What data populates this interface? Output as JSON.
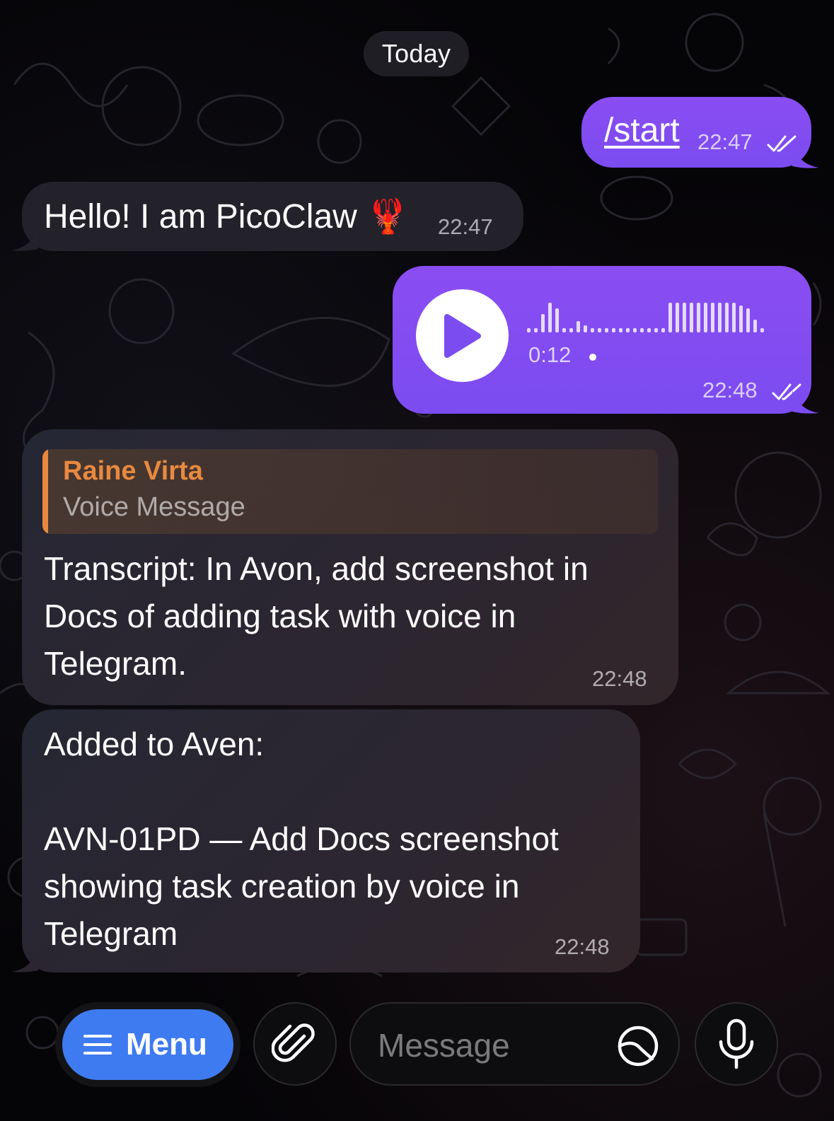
{
  "date_separator": "Today",
  "messages": [
    {
      "id": "start",
      "direction": "outgoing",
      "text": "/start",
      "time": "22:47",
      "status": "read"
    },
    {
      "id": "hello",
      "direction": "incoming",
      "text": "Hello! I am PicoClaw 🦞",
      "time": "22:47"
    },
    {
      "id": "voice",
      "direction": "outgoing",
      "type": "voice",
      "duration": "0:12",
      "time": "22:48",
      "status": "read"
    },
    {
      "id": "transcript",
      "direction": "incoming",
      "reply": {
        "name": "Raine Virta",
        "subtitle": "Voice Message"
      },
      "text": "Transcript: In Avon, add screenshot in Docs of adding task with voice in Telegram.",
      "time": "22:48"
    },
    {
      "id": "added",
      "direction": "incoming",
      "text": "Added to Aven:\n\nAVN-01PD — Add Docs screenshot showing task creation by voice in Telegram",
      "time": "22:48"
    }
  ],
  "bottom_bar": {
    "menu_label": "Menu",
    "message_placeholder": "Message"
  },
  "icons": [
    "menu-icon",
    "attach-icon",
    "sticker-icon",
    "microphone-icon",
    "play-icon",
    "read-check-icon"
  ],
  "colors": {
    "outgoing": "#8a4df2",
    "incoming": "#242230",
    "menu_button": "#3f7bf0",
    "reply_accent": "#e8893f"
  }
}
